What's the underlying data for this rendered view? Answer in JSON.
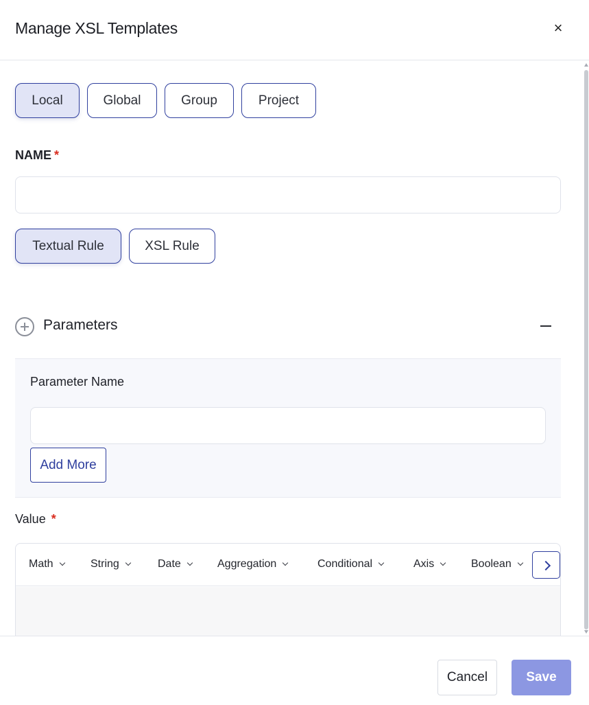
{
  "dialog": {
    "title": "Manage XSL Templates",
    "close_symbol": "×"
  },
  "scope_tabs": [
    {
      "label": "Local",
      "active": true
    },
    {
      "label": "Global",
      "active": false
    },
    {
      "label": "Group",
      "active": false
    },
    {
      "label": "Project",
      "active": false
    }
  ],
  "name_field": {
    "label": "NAME",
    "required_mark": "*",
    "value": "",
    "placeholder": ""
  },
  "rule_tabs": [
    {
      "label": "Textual Rule",
      "active": true
    },
    {
      "label": "XSL Rule",
      "active": false
    }
  ],
  "parameters": {
    "title": "Parameters",
    "param_name_label": "Parameter Name",
    "param_name_value": "",
    "add_more_label": "Add More"
  },
  "value_field": {
    "label": "Value",
    "required_mark": "*"
  },
  "toolbar": {
    "items": [
      "Math",
      "String",
      "Date",
      "Aggregation",
      "Conditional",
      "Axis",
      "Boolean"
    ]
  },
  "footer": {
    "cancel_label": "Cancel",
    "save_label": "Save"
  },
  "colors": {
    "accent": "#2f3f9e",
    "active_tab_bg": "#e1e4f6",
    "save_bg": "#8c97e2",
    "required": "#d92d20"
  }
}
